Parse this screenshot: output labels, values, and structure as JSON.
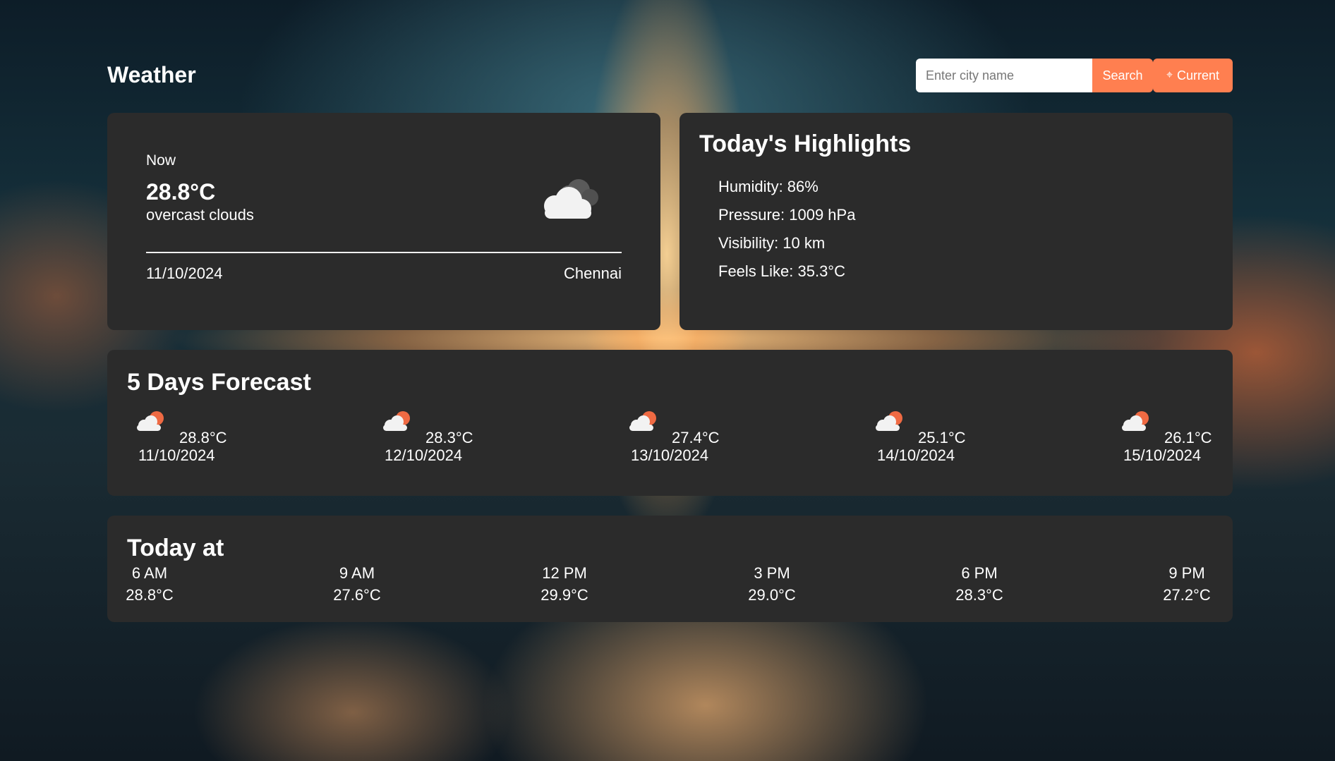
{
  "app": {
    "title": "Weather"
  },
  "search": {
    "placeholder": "Enter city name",
    "value": "",
    "button_label": "Search",
    "current_label": "Current",
    "current_icon": "location-crosshair-icon"
  },
  "colors": {
    "accent": "#ff7f50",
    "card": "#2b2b2b",
    "text": "#ffffff"
  },
  "now": {
    "label": "Now",
    "temperature": "28.8°C",
    "description": "overcast clouds",
    "icon": "overcast-clouds-icon",
    "date": "11/10/2024",
    "city": "Chennai"
  },
  "highlights": {
    "title": "Today's Highlights",
    "items": [
      {
        "label": "Humidity: 86%"
      },
      {
        "label": "Pressure: 1009 hPa"
      },
      {
        "label": "Visibility: 10 km"
      },
      {
        "label": "Feels Like: 35.3°C"
      }
    ]
  },
  "forecast": {
    "title": "5 Days Forecast",
    "days": [
      {
        "temp": "28.8°C",
        "date": "11/10/2024",
        "icon": "sun-behind-cloud-icon"
      },
      {
        "temp": "28.3°C",
        "date": "12/10/2024",
        "icon": "sun-behind-cloud-icon"
      },
      {
        "temp": "27.4°C",
        "date": "13/10/2024",
        "icon": "sun-behind-cloud-icon"
      },
      {
        "temp": "25.1°C",
        "date": "14/10/2024",
        "icon": "sun-behind-cloud-icon"
      },
      {
        "temp": "26.1°C",
        "date": "15/10/2024",
        "icon": "sun-behind-cloud-icon"
      }
    ]
  },
  "today": {
    "title": "Today at",
    "hours": [
      {
        "time": "6 AM",
        "temp": "28.8°C"
      },
      {
        "time": "9 AM",
        "temp": "27.6°C"
      },
      {
        "time": "12 PM",
        "temp": "29.9°C"
      },
      {
        "time": "3 PM",
        "temp": "29.0°C"
      },
      {
        "time": "6 PM",
        "temp": "28.3°C"
      },
      {
        "time": "9 PM",
        "temp": "27.2°C"
      }
    ]
  }
}
